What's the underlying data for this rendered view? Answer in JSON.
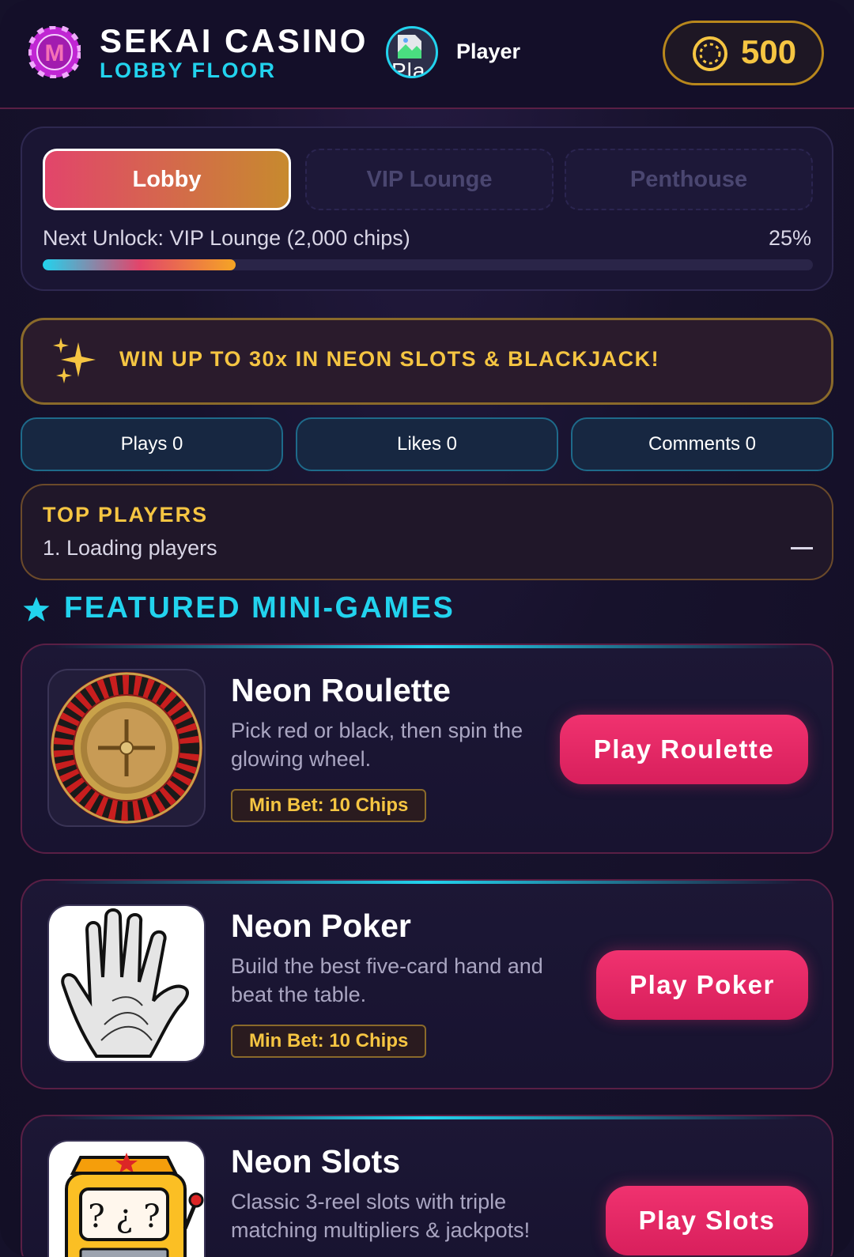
{
  "header": {
    "title": "SEKAI CASINO",
    "subtitle": "LOBBY FLOOR",
    "player_name": "Player",
    "avatar_text": "Pla",
    "chips": "500",
    "logo_letter": "M"
  },
  "floors": {
    "tabs": [
      {
        "label": "Lobby",
        "active": true
      },
      {
        "label": "VIP Lounge",
        "active": false
      },
      {
        "label": "Penthouse",
        "active": false
      }
    ],
    "next_unlock": "Next Unlock: VIP Lounge (2,000 chips)",
    "progress_label": "25%",
    "progress": 0.25
  },
  "promo": {
    "text": "WIN UP TO 30x IN NEON SLOTS & BLACKJACK!"
  },
  "stats": {
    "plays": "Plays 0",
    "likes": "Likes 0",
    "comments": "Comments 0"
  },
  "top_players": {
    "title": "TOP PLAYERS",
    "rows": [
      "1. Loading players"
    ]
  },
  "featured": {
    "title": "FEATURED MINI-GAMES",
    "games": [
      {
        "title": "Neon Roulette",
        "description": "Pick red or black, then spin the glowing wheel.",
        "min_bet": "Min Bet: 10 Chips",
        "button": "Play Roulette"
      },
      {
        "title": "Neon Poker",
        "description": "Build the best five-card hand and beat the table.",
        "min_bet": "Min Bet: 10 Chips",
        "button": "Play Poker"
      },
      {
        "title": "Neon Slots",
        "description": "Classic 3-reel slots with triple matching multipliers & jackpots!",
        "button": "Play Slots"
      }
    ]
  },
  "colors": {
    "accent_cyan": "#22d3ee",
    "accent_gold": "#f5c542",
    "accent_pink": "#f0326f",
    "background": "#15112a"
  }
}
